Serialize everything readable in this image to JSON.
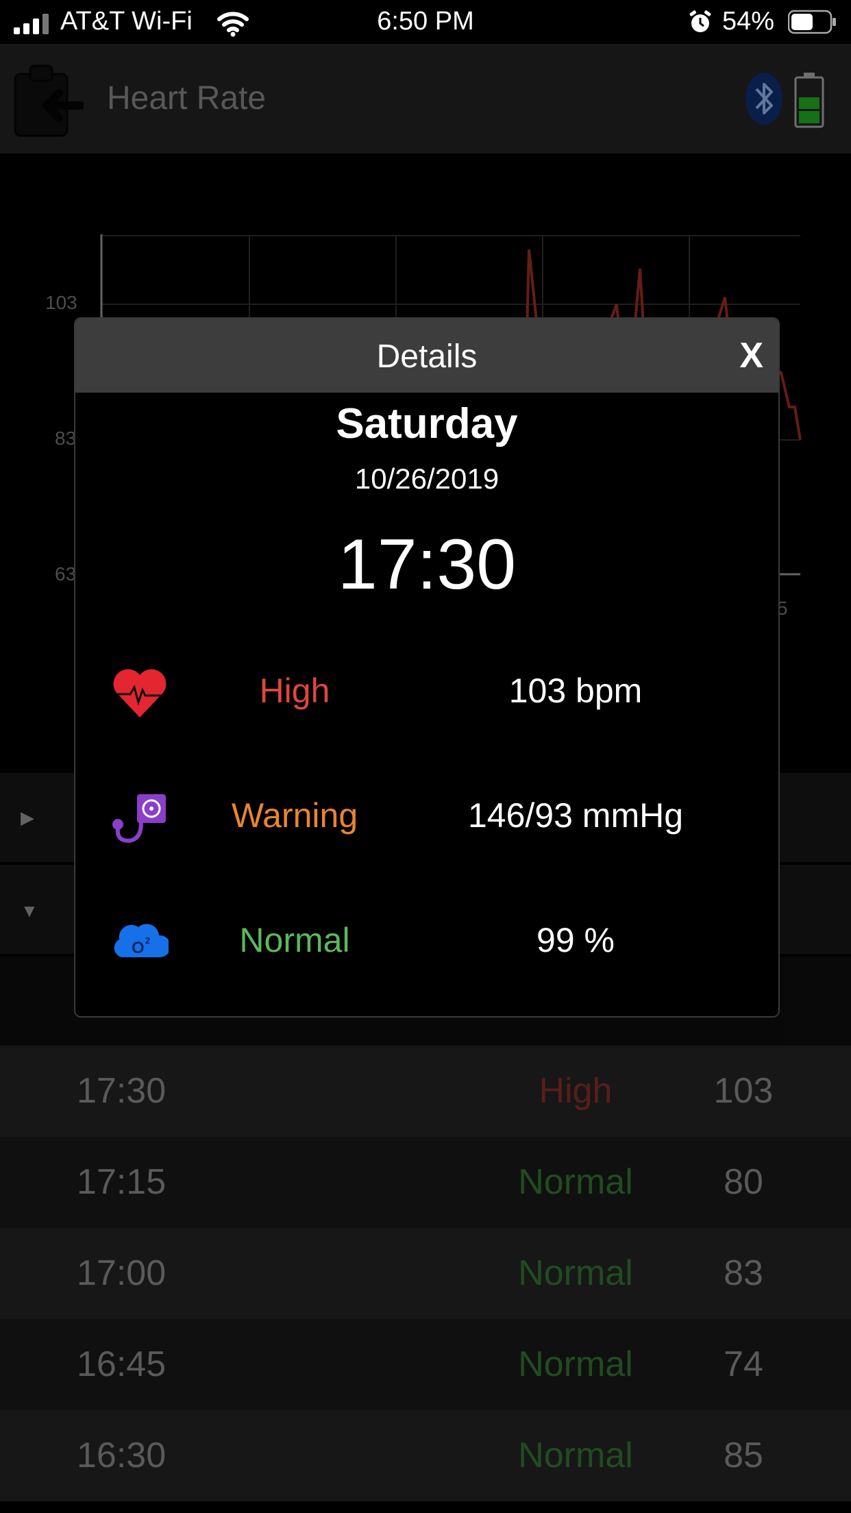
{
  "status_bar": {
    "carrier": "AT&T Wi-Fi",
    "time": "6:50 PM",
    "battery": "54%"
  },
  "header": {
    "title": "Heart Rate"
  },
  "chart": {
    "y_ticks": [
      "103",
      "83",
      "63"
    ],
    "x_tick_partial": "5",
    "line_color": "#8b2a1c"
  },
  "modal": {
    "title": "Details",
    "close_label": "X",
    "day": "Saturday",
    "date": "10/26/2019",
    "time": "17:30",
    "metrics": [
      {
        "icon": "heart-icon",
        "status": "High",
        "status_color": "#e0463e",
        "value": "103 bpm"
      },
      {
        "icon": "blood-pressure-icon",
        "status": "Warning",
        "status_color": "#e8862f",
        "value": "146/93 mmHg"
      },
      {
        "icon": "oxygen-icon",
        "status": "Normal",
        "status_color": "#5cb85c",
        "value": "99 %"
      }
    ]
  },
  "list": {
    "rows": [
      {
        "time": "17:30",
        "status": "High",
        "value": "103",
        "status_color": "#7a2a24"
      },
      {
        "time": "17:15",
        "status": "Normal",
        "value": "80",
        "status_color": "#2f6a2f"
      },
      {
        "time": "17:00",
        "status": "Normal",
        "value": "83",
        "status_color": "#2f6a2f"
      },
      {
        "time": "16:45",
        "status": "Normal",
        "value": "74",
        "status_color": "#2f6a2f"
      },
      {
        "time": "16:30",
        "status": "Normal",
        "value": "85",
        "status_color": "#2f6a2f"
      }
    ]
  }
}
